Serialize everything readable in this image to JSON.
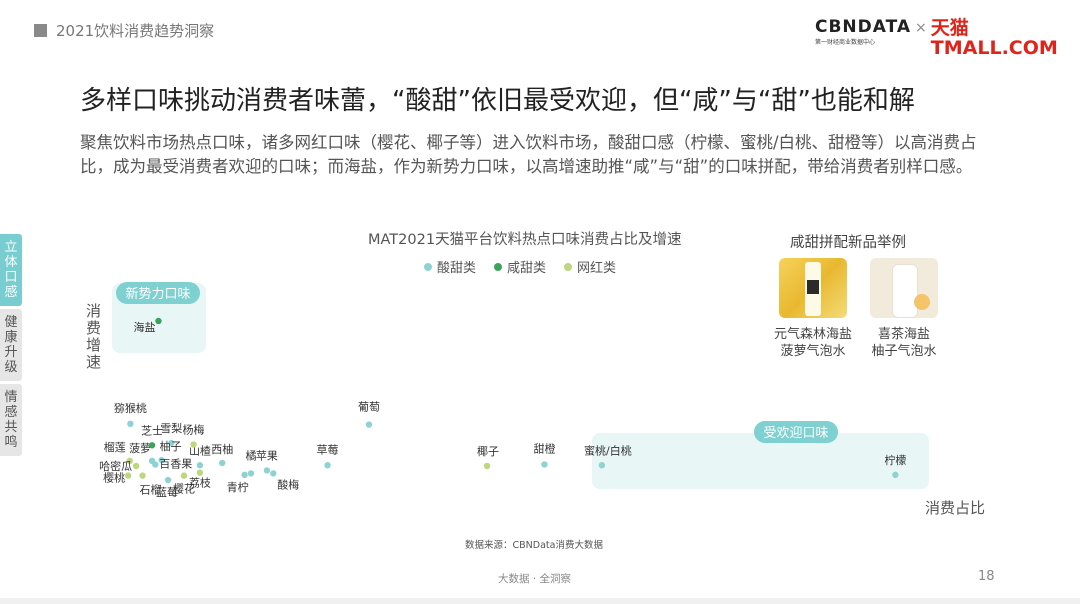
{
  "header": {
    "title": "2021饮料消费趋势洞察",
    "brand_left": "CBNDATA",
    "brand_left_sub": "第一财经商业数据中心",
    "brand_sep": "×",
    "brand_right": "天猫TMALL.COM"
  },
  "headline": "多样口味挑动消费者味蕾，“酸甜”依旧最受欢迎，但“咸”与“甜”也能和解",
  "intro": "聚焦饮料市场热点口味，诸多网红口味（樱花、椰子等）进入饮料市场，酸甜口感（柠檬、蜜桃/白桃、甜橙等）以高消费占比，成为最受消费者欢迎的口味；而海盐，作为新势力口味，以高增速助推“咸”与“甜”的口味拼配，带给消费者别样口感。",
  "side_tabs": [
    {
      "label": "立体口感",
      "active": true
    },
    {
      "label": "健康升级",
      "active": false
    },
    {
      "label": "情感共鸣",
      "active": false
    }
  ],
  "colors": {
    "sweet_sour": "#8ed3d3",
    "salty_sweet": "#3aa45c",
    "internet_famous": "#bcd87e",
    "highlight_box": "#e5f4f4",
    "highlight_tag": "#7fd0d1"
  },
  "chart_data": {
    "type": "scatter",
    "title": "MAT2021天猫平台饮料热点口味消费占比及增速",
    "xlabel": "消费占比",
    "ylabel": "消费增速",
    "legend": [
      "酸甜类",
      "咸甜类",
      "网红类"
    ],
    "legend_position": "top",
    "grid": false,
    "series": [
      {
        "name": "酸甜类",
        "points": [
          {
            "label": "猕猴桃",
            "x": 0.42,
            "y": 0.57
          },
          {
            "label": "雪梨",
            "x": 1.7,
            "y": 0.31
          },
          {
            "label": "柚子",
            "x": 1.4,
            "y": 0.08
          },
          {
            "label": "菠萝",
            "x": 1.1,
            "y": 0.07
          },
          {
            "label": "百香果",
            "x": 1.2,
            "y": 0.02
          },
          {
            "label": "山楂",
            "x": 2.6,
            "y": 0.01
          },
          {
            "label": "西柚",
            "x": 3.3,
            "y": 0.04
          },
          {
            "label": "橘",
            "x": 4.2,
            "y": -0.1
          },
          {
            "label": "青柠",
            "x": 4.0,
            "y": -0.12
          },
          {
            "label": "苹果",
            "x": 4.7,
            "y": -0.06
          },
          {
            "label": "酸梅",
            "x": 4.9,
            "y": -0.1
          },
          {
            "label": "草莓",
            "x": 6.6,
            "y": 0.01
          },
          {
            "label": "葡萄",
            "x": 7.9,
            "y": 0.56
          },
          {
            "label": "蓝莓",
            "x": 1.6,
            "y": -0.19
          },
          {
            "label": "甜橙",
            "x": 13.4,
            "y": 0.02
          },
          {
            "label": "蜜桃/白桃",
            "x": 15.2,
            "y": 0.01
          },
          {
            "label": "柠檬",
            "x": 24.4,
            "y": -0.12
          }
        ]
      },
      {
        "name": "咸甜类",
        "points": [
          {
            "label": "海盐",
            "x": 1.3,
            "y": 1.96
          },
          {
            "label": "芝士",
            "x": 1.1,
            "y": 0.28
          }
        ]
      },
      {
        "name": "网红类",
        "points": [
          {
            "label": "榴莲",
            "x": 0.4,
            "y": 0.07
          },
          {
            "label": "哈密瓜",
            "x": 0.6,
            "y": 0.0
          },
          {
            "label": "樱桃",
            "x": 0.35,
            "y": -0.13
          },
          {
            "label": "石榴",
            "x": 0.8,
            "y": -0.13
          },
          {
            "label": "杨梅",
            "x": 2.4,
            "y": 0.29
          },
          {
            "label": "樱花",
            "x": 2.1,
            "y": -0.13
          },
          {
            "label": "荔枝",
            "x": 2.6,
            "y": -0.09
          },
          {
            "label": "椰子",
            "x": 11.6,
            "y": 0.0
          }
        ]
      }
    ],
    "annotations": [
      {
        "text": "新势力口味",
        "target": "海盐"
      },
      {
        "text": "受欢迎口味",
        "targets": [
          "椰子",
          "甜橙",
          "蜜桃/白桃",
          "柠檬"
        ]
      }
    ]
  },
  "products": {
    "title": "咸甜拼配新品举例",
    "items": [
      {
        "name": "元气森林海盐\n菠萝气泡水",
        "image": "pineapple-drink-image"
      },
      {
        "name": "喜茶海盐\n柚子气泡水",
        "image": "grapefruit-drink-image"
      }
    ]
  },
  "source": "数据来源：CBNData消费大数据",
  "footer": "大数据 · 全洞察",
  "page_number": "18"
}
